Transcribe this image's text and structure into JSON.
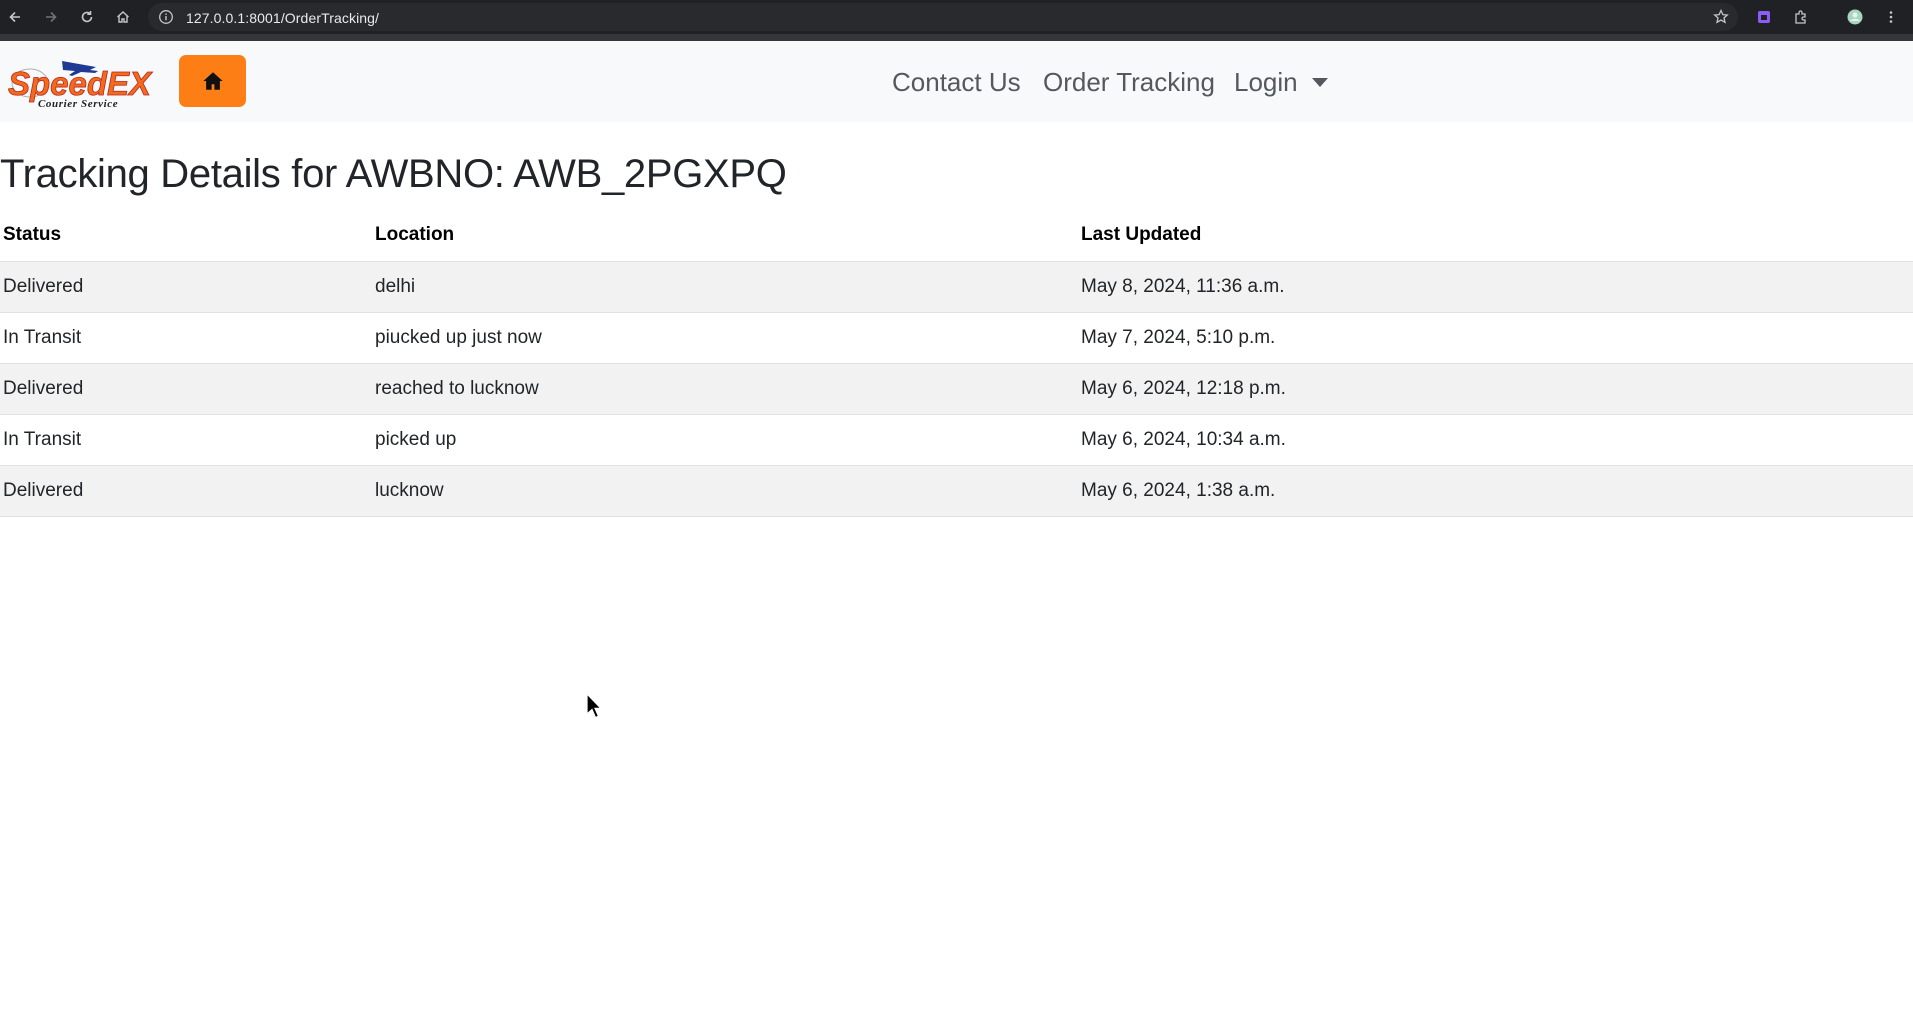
{
  "browser": {
    "url": "127.0.0.1:8001/OrderTracking/",
    "icons": [
      "back-icon",
      "forward-icon",
      "reload-icon",
      "home-icon",
      "site-info-icon",
      "bookmark-star-icon",
      "extension-icon",
      "puzzle-icon",
      "profile-avatar",
      "kebab-menu-icon"
    ]
  },
  "navbar": {
    "logo_alt": "SpeedEX Courier Service",
    "logo_text": "SpeedEX",
    "logo_subtext": "Courier Service",
    "home_button_icon": "house-icon",
    "links": {
      "contact": "Contact Us",
      "tracking": "Order Tracking",
      "login": "Login"
    },
    "accent_color": "#fd7e14"
  },
  "page": {
    "title": "Tracking Details for AWBNO: AWB_2PGXPQ"
  },
  "table": {
    "headers": {
      "status": "Status",
      "location": "Location",
      "updated": "Last Updated"
    },
    "rows": [
      {
        "status": "Delivered",
        "location": "delhi",
        "updated": "May 8, 2024, 11:36 a.m."
      },
      {
        "status": "In Transit",
        "location": "piucked up just now",
        "updated": "May 7, 2024, 5:10 p.m."
      },
      {
        "status": "Delivered",
        "location": "reached to lucknow",
        "updated": "May 6, 2024, 12:18 p.m."
      },
      {
        "status": "In Transit",
        "location": "picked up",
        "updated": "May 6, 2024, 10:34 a.m."
      },
      {
        "status": "Delivered",
        "location": "lucknow",
        "updated": "May 6, 2024, 1:38 a.m."
      }
    ]
  }
}
